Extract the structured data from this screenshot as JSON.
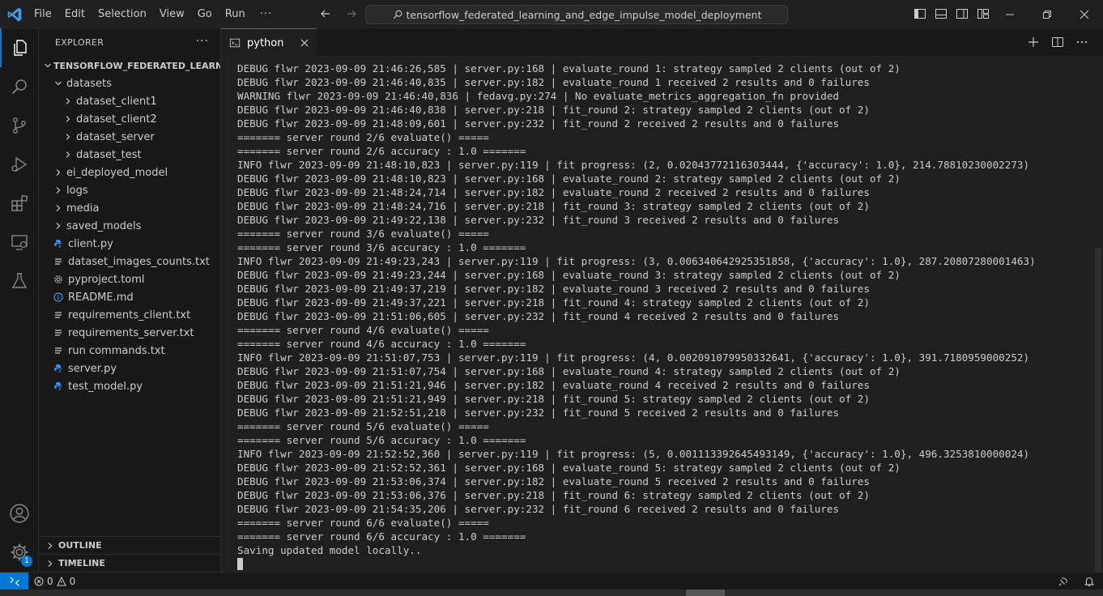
{
  "menu": {
    "items": [
      "File",
      "Edit",
      "Selection",
      "View",
      "Go",
      "Run"
    ],
    "more": "···"
  },
  "search": {
    "text": "tensorflow_federated_learning_and_edge_impulse_model_deployment"
  },
  "explorer": {
    "title": "EXPLORER",
    "root": "TENSORFLOW_FEDERATED_LEARNIN...",
    "tree": [
      {
        "label": "datasets",
        "type": "folder-open",
        "depth": 1
      },
      {
        "label": "dataset_client1",
        "type": "folder",
        "depth": 2
      },
      {
        "label": "dataset_client2",
        "type": "folder",
        "depth": 2
      },
      {
        "label": "dataset_server",
        "type": "folder",
        "depth": 2
      },
      {
        "label": "dataset_test",
        "type": "folder",
        "depth": 2
      },
      {
        "label": "ei_deployed_model",
        "type": "folder",
        "depth": 1
      },
      {
        "label": "logs",
        "type": "folder",
        "depth": 1
      },
      {
        "label": "media",
        "type": "folder",
        "depth": 1
      },
      {
        "label": "saved_models",
        "type": "folder",
        "depth": 1
      },
      {
        "label": "client.py",
        "type": "python",
        "depth": 1
      },
      {
        "label": "dataset_images_counts.txt",
        "type": "text",
        "depth": 1
      },
      {
        "label": "pyproject.toml",
        "type": "toml",
        "depth": 1
      },
      {
        "label": "README.md",
        "type": "info",
        "depth": 1
      },
      {
        "label": "requirements_client.txt",
        "type": "text",
        "depth": 1
      },
      {
        "label": "requirements_server.txt",
        "type": "text",
        "depth": 1
      },
      {
        "label": "run commands.txt",
        "type": "text",
        "depth": 1
      },
      {
        "label": "server.py",
        "type": "python",
        "depth": 1
      },
      {
        "label": "test_model.py",
        "type": "python",
        "depth": 1
      }
    ],
    "outline": "OUTLINE",
    "timeline": "TIMELINE"
  },
  "tab": {
    "label": "python"
  },
  "activity": {
    "accounts_badge": "1"
  },
  "terminal": {
    "lines": [
      "DEBUG flwr 2023-09-09 21:46:26,585 | server.py:168 | evaluate_round 1: strategy sampled 2 clients (out of 2)",
      "DEBUG flwr 2023-09-09 21:46:40,835 | server.py:182 | evaluate_round 1 received 2 results and 0 failures",
      "WARNING flwr 2023-09-09 21:46:40,836 | fedavg.py:274 | No evaluate_metrics_aggregation_fn provided",
      "DEBUG flwr 2023-09-09 21:46:40,838 | server.py:218 | fit_round 2: strategy sampled 2 clients (out of 2)",
      "DEBUG flwr 2023-09-09 21:48:09,601 | server.py:232 | fit_round 2 received 2 results and 0 failures",
      "======= server round 2/6 evaluate() =====",
      "======= server round 2/6 accuracy : 1.0 =======",
      "INFO flwr 2023-09-09 21:48:10,823 | server.py:119 | fit progress: (2, 0.02043772116303444, {'accuracy': 1.0}, 214.78810230002273)",
      "DEBUG flwr 2023-09-09 21:48:10,823 | server.py:168 | evaluate_round 2: strategy sampled 2 clients (out of 2)",
      "DEBUG flwr 2023-09-09 21:48:24,714 | server.py:182 | evaluate_round 2 received 2 results and 0 failures",
      "DEBUG flwr 2023-09-09 21:48:24,716 | server.py:218 | fit_round 3: strategy sampled 2 clients (out of 2)",
      "DEBUG flwr 2023-09-09 21:49:22,138 | server.py:232 | fit_round 3 received 2 results and 0 failures",
      "======= server round 3/6 evaluate() =====",
      "======= server round 3/6 accuracy : 1.0 =======",
      "INFO flwr 2023-09-09 21:49:23,243 | server.py:119 | fit progress: (3, 0.006340642925351858, {'accuracy': 1.0}, 287.20807280001463)",
      "DEBUG flwr 2023-09-09 21:49:23,244 | server.py:168 | evaluate_round 3: strategy sampled 2 clients (out of 2)",
      "DEBUG flwr 2023-09-09 21:49:37,219 | server.py:182 | evaluate_round 3 received 2 results and 0 failures",
      "DEBUG flwr 2023-09-09 21:49:37,221 | server.py:218 | fit_round 4: strategy sampled 2 clients (out of 2)",
      "DEBUG flwr 2023-09-09 21:51:06,605 | server.py:232 | fit_round 4 received 2 results and 0 failures",
      "======= server round 4/6 evaluate() =====",
      "======= server round 4/6 accuracy : 1.0 =======",
      "INFO flwr 2023-09-09 21:51:07,753 | server.py:119 | fit progress: (4, 0.002091079950332641, {'accuracy': 1.0}, 391.7180959000252)",
      "DEBUG flwr 2023-09-09 21:51:07,754 | server.py:168 | evaluate_round 4: strategy sampled 2 clients (out of 2)",
      "DEBUG flwr 2023-09-09 21:51:21,946 | server.py:182 | evaluate_round 4 received 2 results and 0 failures",
      "DEBUG flwr 2023-09-09 21:51:21,949 | server.py:218 | fit_round 5: strategy sampled 2 clients (out of 2)",
      "DEBUG flwr 2023-09-09 21:52:51,210 | server.py:232 | fit_round 5 received 2 results and 0 failures",
      "======= server round 5/6 evaluate() =====",
      "======= server round 5/6 accuracy : 1.0 =======",
      "INFO flwr 2023-09-09 21:52:52,360 | server.py:119 | fit progress: (5, 0.001113392645493149, {'accuracy': 1.0}, 496.3253810000024)",
      "DEBUG flwr 2023-09-09 21:52:52,361 | server.py:168 | evaluate_round 5: strategy sampled 2 clients (out of 2)",
      "DEBUG flwr 2023-09-09 21:53:06,374 | server.py:182 | evaluate_round 5 received 2 results and 0 failures",
      "DEBUG flwr 2023-09-09 21:53:06,376 | server.py:218 | fit_round 6: strategy sampled 2 clients (out of 2)",
      "DEBUG flwr 2023-09-09 21:54:35,206 | server.py:232 | fit_round 6 received 2 results and 0 failures",
      "======= server round 6/6 evaluate() =====",
      "======= server round 6/6 accuracy : 1.0 =======",
      "Saving updated model locally.."
    ]
  },
  "status": {
    "errors": "0",
    "warnings": "0"
  },
  "colors": {
    "accent": "#0078d4",
    "background": "#1f1f1f",
    "sidebar": "#181818",
    "python_icon": "#3b8eea",
    "toml_icon": "#9d9d9d"
  }
}
